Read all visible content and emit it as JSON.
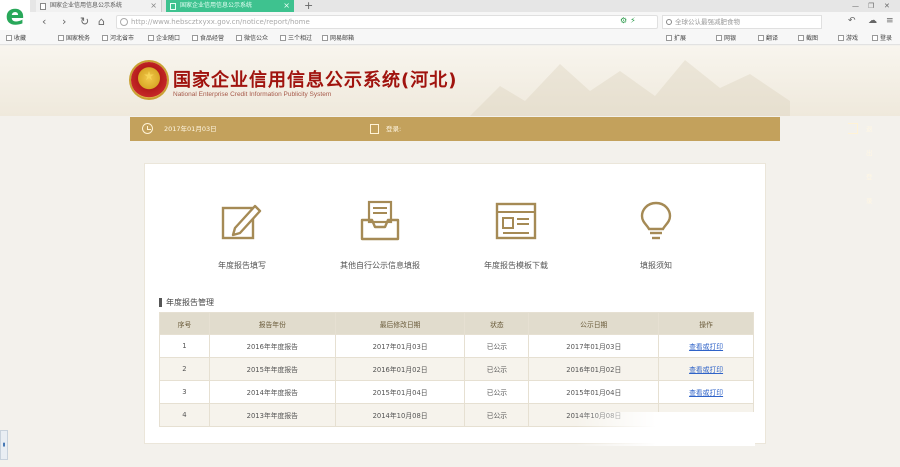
{
  "browser": {
    "tabs": [
      {
        "label": "国家企业信用信息公示系统"
      },
      {
        "label": "国家企业信用信息公示系统"
      }
    ],
    "new_tab": "+",
    "url": "http://www.hebscztxyxx.gov.cn/notice/report/home",
    "search_placeholder": "全球公认最强减肥食物",
    "bookmarks": [
      "收藏",
      "国家税务",
      "河北省市",
      "企业随口",
      "食品经营",
      "微信公众",
      "三个相过",
      "网易邮箱"
    ],
    "right_tools": [
      "扩展",
      "网银",
      "翻译",
      "截图",
      "游戏",
      "登录"
    ]
  },
  "header": {
    "title": "国家企业信用信息公示系统(河北)",
    "subtitle": "National Enterprise Credit Information Publicity System"
  },
  "info_bar": {
    "date": "2017年01月03日",
    "company": "登录:    ",
    "logout": "退出登录"
  },
  "functions": [
    {
      "label": "年度报告填写",
      "icon": "pencil-edit-icon"
    },
    {
      "label": "其他自行公示信息填报",
      "icon": "inbox-tray-icon"
    },
    {
      "label": "年度报告模板下载",
      "icon": "report-template-icon"
    },
    {
      "label": "填报须知",
      "icon": "lightbulb-icon"
    }
  ],
  "section_title": "年度报告管理",
  "table": {
    "headers": [
      "序号",
      "报告年份",
      "最后修改日期",
      "状态",
      "公示日期",
      "操作"
    ],
    "rows": [
      {
        "no": "1",
        "year": "2016年年度报告",
        "modified": "2017年01月03日",
        "status": "已公示",
        "published": "2017年01月03日",
        "action": "查看或打印"
      },
      {
        "no": "2",
        "year": "2015年年度报告",
        "modified": "2016年01月02日",
        "status": "已公示",
        "published": "2016年01月02日",
        "action": "查看或打印"
      },
      {
        "no": "3",
        "year": "2014年年度报告",
        "modified": "2015年01月04日",
        "status": "已公示",
        "published": "2015年01月04日",
        "action": "查看或打印"
      },
      {
        "no": "4",
        "year": "2013年年度报告",
        "modified": "2014年10月08日",
        "status": "已公示",
        "published": "2014年10月08日",
        "action": ""
      }
    ]
  },
  "colors": {
    "gold": "#c3a15c",
    "title_red": "#a0130e",
    "link": "#2f63c8",
    "table_header": "#e1dccd"
  }
}
